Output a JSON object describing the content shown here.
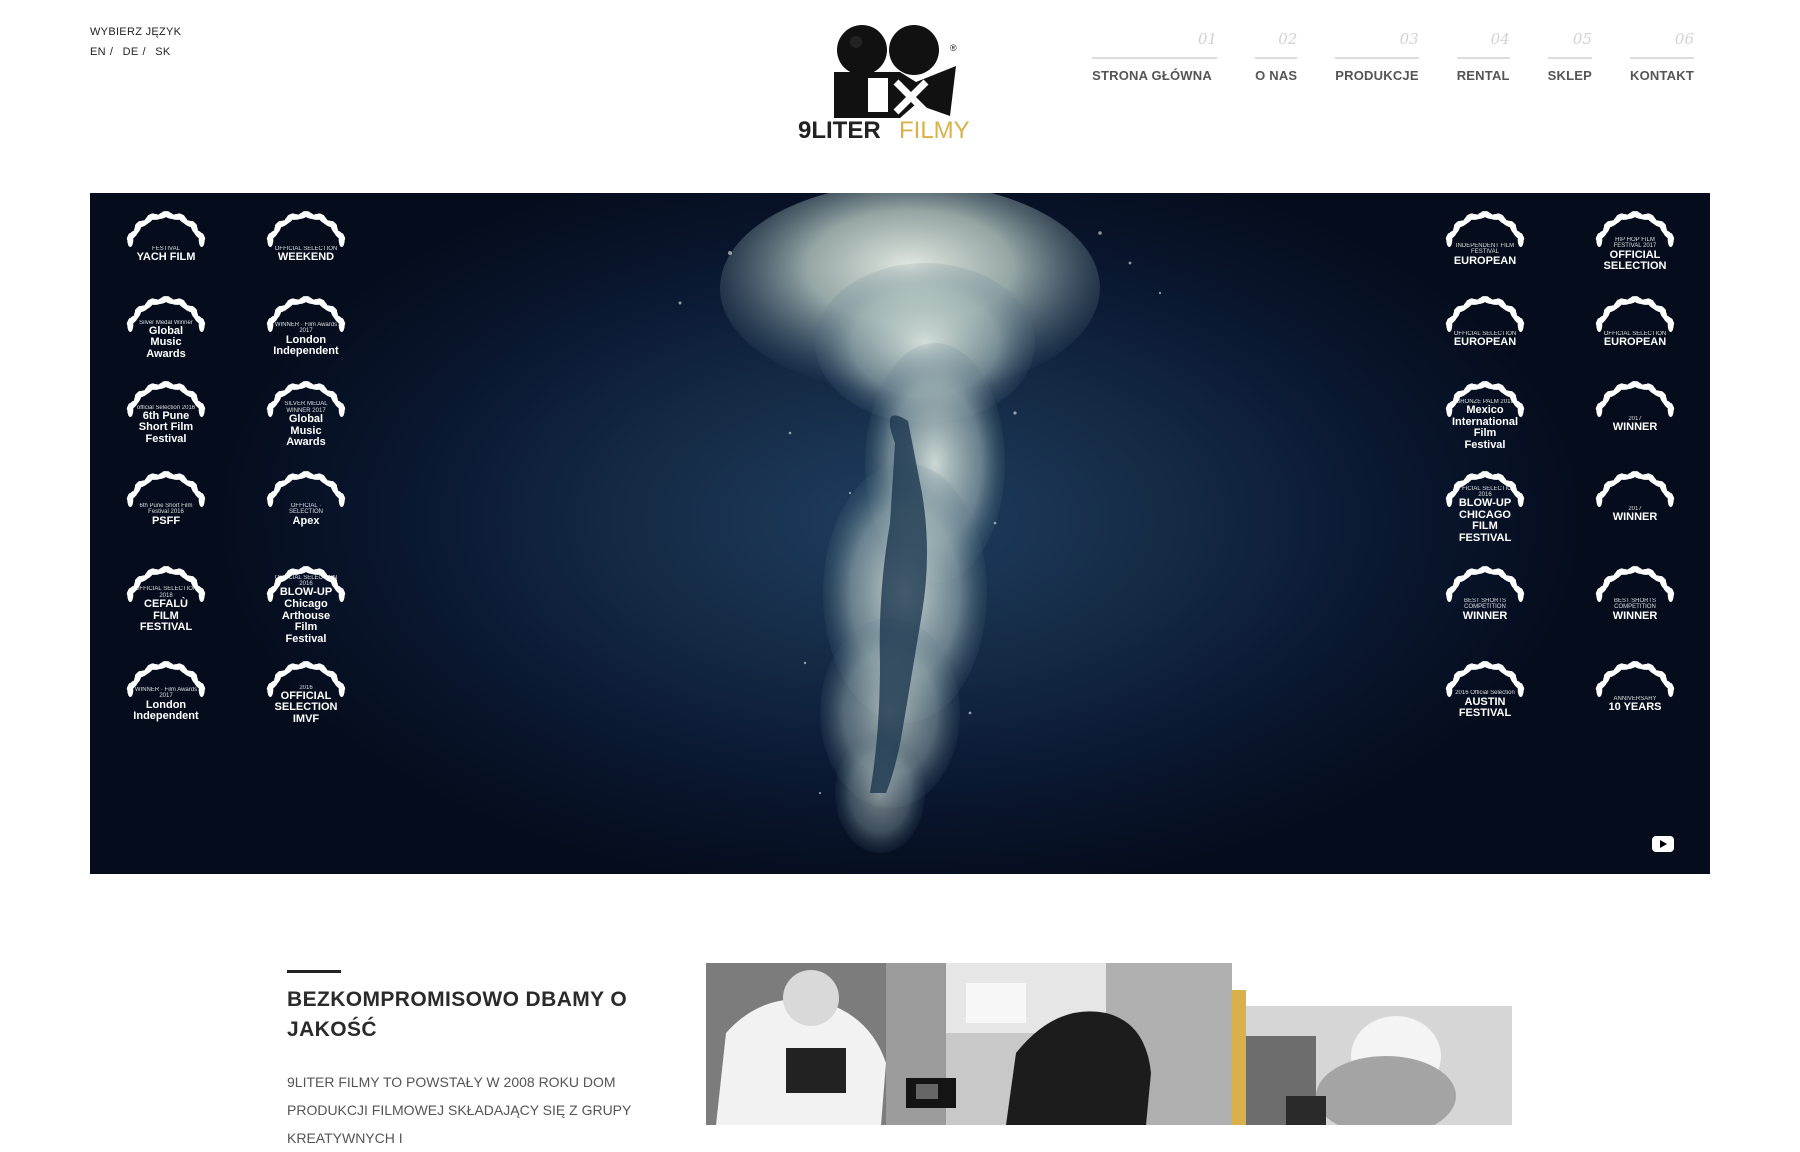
{
  "language": {
    "title": "WYBIERZ JĘZYK",
    "links": [
      "EN",
      "DE",
      "SK"
    ]
  },
  "logo": {
    "word1": "9LITER",
    "word2": "FILMY",
    "registered": "®",
    "accent_color": "#d8b14a"
  },
  "nav": [
    {
      "num": "01",
      "label": "STRONA GŁÓWNA"
    },
    {
      "num": "02",
      "label": "O NAS"
    },
    {
      "num": "03",
      "label": "PRODUKCJE"
    },
    {
      "num": "04",
      "label": "RENTAL"
    },
    {
      "num": "05",
      "label": "SKLEP"
    },
    {
      "num": "06",
      "label": "KONTAKT"
    }
  ],
  "hero": {
    "laurels_left": [
      {
        "big": "YACH FILM",
        "small": "FESTIVAL"
      },
      {
        "big": "WEEKEND",
        "small": "OFFICIAL SELECTION"
      },
      {
        "big": "Global Music Awards",
        "small": "Silver Medal Winner"
      },
      {
        "big": "London Independent",
        "small": "WINNER · Film Awards 2017"
      },
      {
        "big": "6th Pune Short Film Festival",
        "small": "official Selection 2016"
      },
      {
        "big": "Global Music Awards",
        "small": "SILVER MEDAL WINNER 2017"
      },
      {
        "big": "PSFF",
        "small": "6th Pune Short Film Festival 2016"
      },
      {
        "big": "Apex",
        "small": "OFFICIAL · SELECTION"
      },
      {
        "big": "CEFALÙ FILM FESTIVAL",
        "small": "OFFICIAL SELECTION 2018"
      },
      {
        "big": "BLOW-UP Chicago Arthouse Film Festival",
        "small": "OFFICIAL SELECTION 2016"
      },
      {
        "big": "London Independent",
        "small": "WINNER · Film Awards 2017"
      },
      {
        "big": "OFFICIAL SELECTION IMVF",
        "small": "2016"
      }
    ],
    "laurels_right": [
      {
        "big": "EUROPEAN",
        "small": "INDEPENDENT FILM FESTIVAL"
      },
      {
        "big": "OFFICIAL SELECTION",
        "small": "HIP HOP FILM FESTIVAL 2017"
      },
      {
        "big": "EUROPEAN",
        "small": "OFFICIAL SELECTION"
      },
      {
        "big": "EUROPEAN",
        "small": "OFFICIAL SELECTION"
      },
      {
        "big": "Mexico International Film Festival",
        "small": "BRONZE PALM 2018"
      },
      {
        "big": "WINNER",
        "small": "2017"
      },
      {
        "big": "BLOW-UP CHICAGO FILM FESTIVAL",
        "small": "OFFICIAL SELECTION 2016"
      },
      {
        "big": "WINNER",
        "small": "2017"
      },
      {
        "big": "WINNER",
        "small": "BEST SHORTS COMPETITION"
      },
      {
        "big": "WINNER",
        "small": "BEST SHORTS COMPETITION"
      },
      {
        "big": "AUSTIN FESTIVAL",
        "small": "2016 Official Selection"
      },
      {
        "big": "10 YEARS",
        "small": "ANNIVERSARY"
      }
    ],
    "video_icon": "youtube-icon"
  },
  "about": {
    "title": "BEZKOMPROMISOWO DBAMY O JAKOŚĆ",
    "body": "9LITER FILMY TO POWSTAŁY W 2008 ROKU DOM PRODUKCJI FILMOWEJ SKŁADAJĄCY SIĘ Z GRUPY KREATYWNYCH I"
  },
  "colors": {
    "hero_dark": "#0a1730",
    "accent_gold": "#d8b14a",
    "nav_text": "#555555"
  }
}
